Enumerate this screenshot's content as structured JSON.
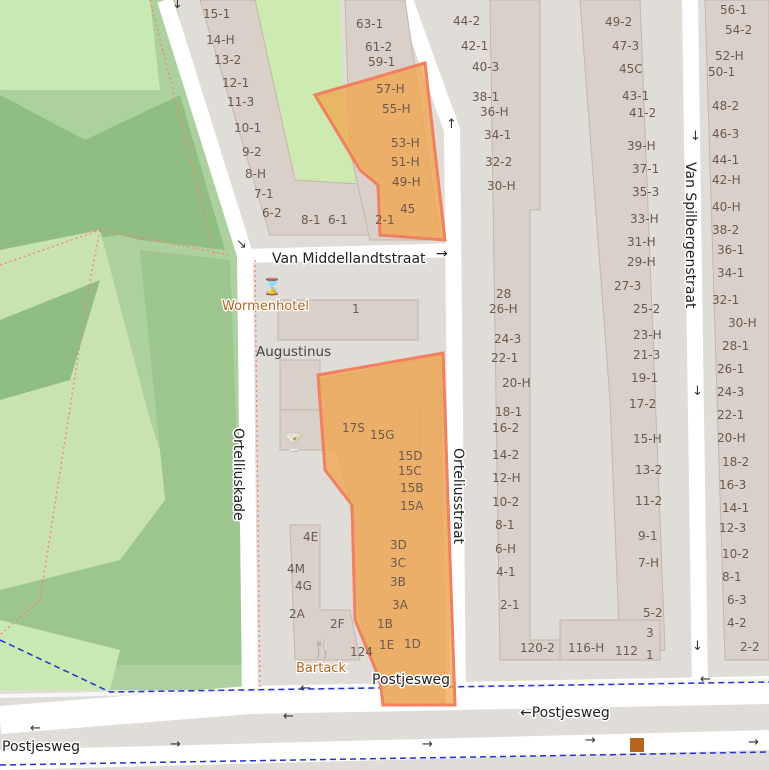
{
  "colors": {
    "park": "#add19e",
    "forest": "#9cc68e",
    "grass": "#c8eab2",
    "residential": "#e0dcd8",
    "road": "#ffffff",
    "building": "#d9d0c9",
    "building_outline": "#c4b6ab",
    "highlight_fill": "#f2a44a",
    "highlight_stroke": "#f08060",
    "footway": "#fa8072",
    "bus_route": "#2233cc",
    "poi": "#b5651d"
  },
  "streets": [
    {
      "label": "Van Middellandtstraat",
      "arrow": "→"
    },
    {
      "label": "Ortelliuskade"
    },
    {
      "label": "Orteliusstraat"
    },
    {
      "label": "Van Spilbergenstraat"
    },
    {
      "label": "Postjesweg"
    },
    {
      "label": "←Postjesweg"
    },
    {
      "label": "Postjesweg"
    }
  ],
  "pois": [
    {
      "label": "Wormenhotel",
      "icon": "hourglass-icon"
    },
    {
      "label": "Bartack",
      "icon": "restaurant-icon"
    },
    {
      "label": "",
      "icon": "bar-icon"
    },
    {
      "label": "",
      "icon": "bus-stop-icon"
    }
  ],
  "places": [
    {
      "label": "Augustinus"
    }
  ],
  "house_numbers": [
    "15-1",
    "14-H",
    "13-2",
    "12-1",
    "11-3",
    "10-1",
    "9-2",
    "8-H",
    "7-1",
    "6-2",
    "8-1",
    "6-1",
    "2-1",
    "63-1",
    "61-2",
    "59-1",
    "57-H",
    "55-H",
    "53-H",
    "51-H",
    "49-H",
    "45",
    "44-2",
    "42-1",
    "40-3",
    "38-1",
    "36-H",
    "34-1",
    "32-2",
    "30-H",
    "28",
    "26-H",
    "24-3",
    "22-1",
    "20-H",
    "18-1",
    "16-2",
    "14-2",
    "12-H",
    "10-2",
    "8-1",
    "6-H",
    "4-1",
    "2-1",
    "49-2",
    "47-3",
    "45C",
    "43-1",
    "41-2",
    "39-H",
    "37-1",
    "35-3",
    "33-H",
    "31-H",
    "29-H",
    "27-3",
    "25-2",
    "23-H",
    "21-3",
    "19-1",
    "17-2",
    "15-H",
    "13-2",
    "11-2",
    "9-1",
    "7-H",
    "5-2",
    "3",
    "1",
    "120-2",
    "116-H",
    "112",
    "56-1",
    "54-2",
    "52-H",
    "50-1",
    "48-2",
    "46-3",
    "44-1",
    "42-H",
    "40-H",
    "38-2",
    "36-1",
    "34-1",
    "32-1",
    "30-H",
    "28-1",
    "26-1",
    "24-3",
    "22-1",
    "20-H",
    "18-2",
    "16-3",
    "14-1",
    "12-3",
    "10-2",
    "8-1",
    "6-3",
    "4-2",
    "2-2",
    "1",
    "17S",
    "15G",
    "15D",
    "15C",
    "15B",
    "15A",
    "3D",
    "3C",
    "3B",
    "3A",
    "1B",
    "1E",
    "1D",
    "4E",
    "4M",
    "4G",
    "2A",
    "2F",
    "124"
  ]
}
